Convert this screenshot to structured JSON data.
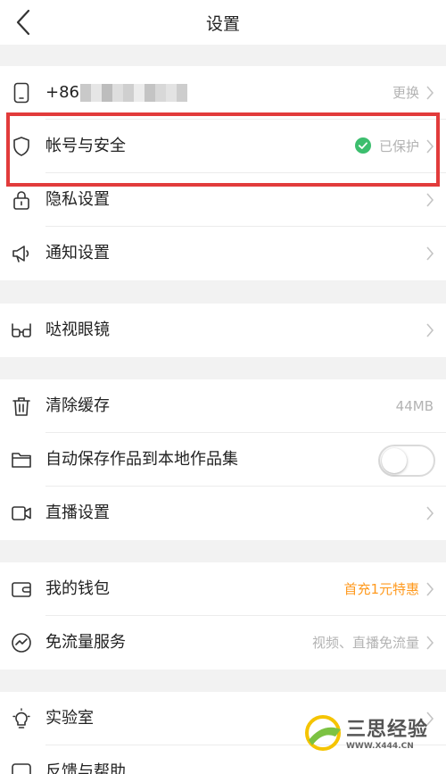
{
  "header": {
    "title": "设置",
    "back_icon": "chevron-left-icon"
  },
  "colors": {
    "highlight": "#e23b3b",
    "accent_orange": "#ff9a1f",
    "protected_green": "#3cbe6e"
  },
  "sections": [
    {
      "items": [
        {
          "icon": "phone-icon",
          "label": "+86",
          "value": "更换",
          "blurred_number": true
        },
        {
          "icon": "shield-icon",
          "label": "帐号与安全",
          "value": "已保护",
          "status_icon": "check-circle-icon"
        }
      ]
    },
    {
      "items": [
        {
          "icon": "lock-icon",
          "label": "隐私设置",
          "value": ""
        },
        {
          "icon": "speaker-icon",
          "label": "通知设置",
          "value": ""
        }
      ]
    },
    {
      "items": [
        {
          "icon": "glasses-icon",
          "label": "哒视眼镜",
          "value": ""
        }
      ]
    },
    {
      "items": [
        {
          "icon": "trash-icon",
          "label": "清除缓存",
          "value": "44MB"
        },
        {
          "icon": "folder-icon",
          "label": "自动保存作品到本地作品集",
          "toggle": false
        },
        {
          "icon": "video-camera-icon",
          "label": "直播设置",
          "value": ""
        }
      ]
    },
    {
      "items": [
        {
          "icon": "wallet-icon",
          "label": "我的钱包",
          "value": "首充1元特惠"
        },
        {
          "icon": "traffic-icon",
          "label": "免流量服务",
          "value": "视频、直播免流量"
        }
      ]
    },
    {
      "items": [
        {
          "icon": "lightbulb-icon",
          "label": "实验室",
          "value": ""
        },
        {
          "icon": "help-icon",
          "label": "反馈与帮助",
          "value": ""
        }
      ]
    }
  ],
  "watermark": {
    "text": "三思经验",
    "url": "WWW.X444.CN"
  }
}
